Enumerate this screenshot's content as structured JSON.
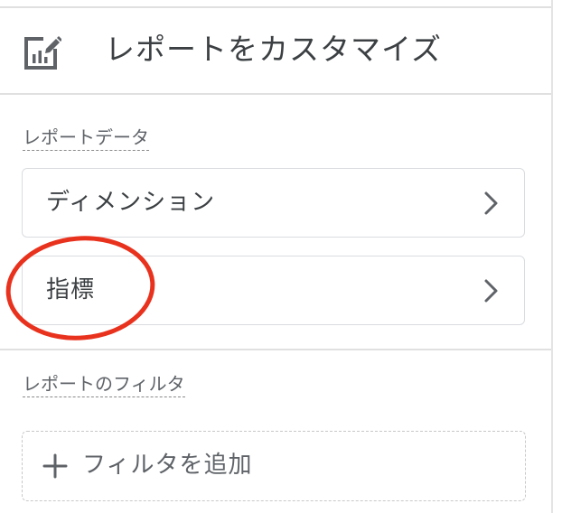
{
  "header": {
    "title": "レポートをカスタマイズ",
    "icon": "report-edit-icon"
  },
  "report_data_section": {
    "label": "レポートデータ",
    "items": [
      {
        "label": "ディメンション",
        "icon": "chevron-right-icon"
      },
      {
        "label": "指標",
        "icon": "chevron-right-icon"
      }
    ]
  },
  "filter_section": {
    "label": "レポートのフィルタ",
    "add_filter_label": "フィルタを追加",
    "add_icon": "plus-icon"
  },
  "annotation": {
    "color": "#e8321e",
    "shape": "ellipse"
  },
  "colors": {
    "text": "#3c4043",
    "secondary_text": "#5f6368",
    "border": "#dadce0"
  }
}
